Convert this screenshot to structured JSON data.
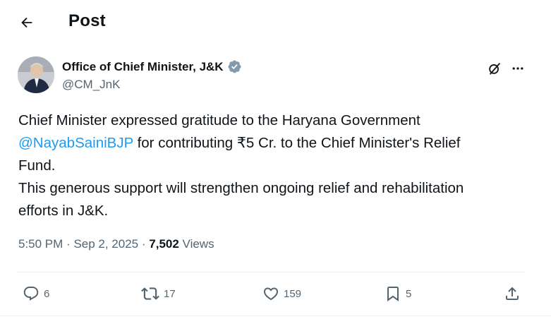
{
  "header": {
    "title": "Post"
  },
  "author": {
    "name": "Office of Chief Minister, J&K",
    "handle": "@CM_JnK",
    "verified": true
  },
  "tweet": {
    "line1": "Chief Minister expressed gratitude to the Haryana Government",
    "mention": "@NayabSainiBJP",
    "line2_rest": " for contributing ₹5 Cr. to the Chief Minister's Relief",
    "line3": "Fund.",
    "line4": "This generous support will strengthen ongoing relief and rehabilitation",
    "line5": "efforts in J&K."
  },
  "meta": {
    "time": "5:50 PM",
    "date": "Sep 2, 2025",
    "views_count": "7,502",
    "views_label": "Views"
  },
  "actions": {
    "replies": "6",
    "reposts": "17",
    "likes": "159",
    "bookmarks": "5"
  },
  "colors": {
    "accent": "#1d9bf0",
    "muted": "#536471",
    "text": "#0f1419"
  },
  "icons": {
    "back": "arrow-left-icon",
    "verified": "verified-badge-icon",
    "grok": "grok-icon",
    "more": "more-dots-icon",
    "reply": "reply-icon",
    "repost": "repost-icon",
    "like": "heart-icon",
    "bookmark": "bookmark-icon",
    "share": "share-icon"
  }
}
